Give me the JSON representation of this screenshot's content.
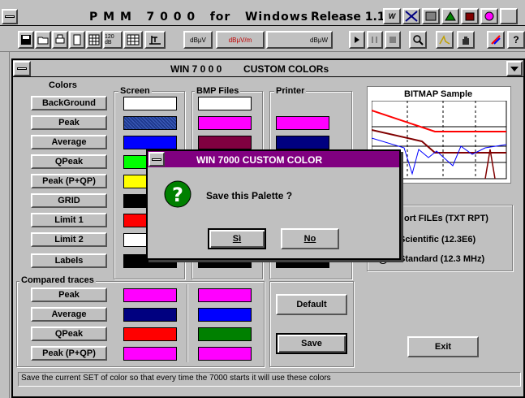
{
  "app": {
    "title": "P M M   7 0 0 0   for   Windows",
    "release": "Release 1.10"
  },
  "toolbar": {
    "unit_labels": [
      "dBμV",
      "dBμV/m",
      "dBμW"
    ],
    "bw_label": "120 dB"
  },
  "window": {
    "title": "WIN 7 0 0 0        CUSTOM COLORs"
  },
  "colors": {
    "section_label": "Colors",
    "columns": [
      "Screen",
      "BMP Files",
      "Printer"
    ],
    "rows": [
      {
        "label": "BackGround",
        "screen": "#ffffff",
        "bmp": "#ffffff",
        "printer": null
      },
      {
        "label": "Peak",
        "screen": "#1f3a8f",
        "bmp": "#ff00ff",
        "printer": "#ff00ff"
      },
      {
        "label": "Average",
        "screen": "#0000ff",
        "bmp": "#800040",
        "printer": "#000080"
      },
      {
        "label": "QPeak",
        "screen": "#00ff00",
        "bmp": null,
        "printer": null
      },
      {
        "label": "Peak  (P+QP)",
        "screen": "#ffff00",
        "bmp": null,
        "printer": null
      },
      {
        "label": "GRID",
        "screen": "#000000",
        "bmp": null,
        "printer": null
      },
      {
        "label": "Limit 1",
        "screen": "#ff0000",
        "bmp": null,
        "printer": null
      },
      {
        "label": "Limit 2",
        "screen": "#ffffff",
        "bmp": null,
        "printer": null
      },
      {
        "label": "Labels",
        "screen": "#000000",
        "bmp": "#000000",
        "printer": "#000000"
      }
    ]
  },
  "compared": {
    "section_label": "Compared traces",
    "rows": [
      {
        "label": "Peak",
        "screen": "#ff00ff",
        "bmp": "#ff00ff"
      },
      {
        "label": "Average",
        "screen": "#000080",
        "bmp": "#0000ff"
      },
      {
        "label": "QPeak",
        "screen": "#ff0000",
        "bmp": "#008000"
      },
      {
        "label": "Peak  (P+QP)",
        "screen": "#ff00ff",
        "bmp": "#ff00ff"
      }
    ]
  },
  "buttons": {
    "default": "Default",
    "save": "Save",
    "exit": "Exit"
  },
  "preview": {
    "label": "BITMAP Sample"
  },
  "export": {
    "group_label": "Export FILEs (TXT RPT)",
    "visible_group_label": "ort FILEs (TXT RPT)",
    "option_scientific": "Scientific (12.3E6)",
    "option_standard": "Standard (12.3 MHz)"
  },
  "dialog": {
    "title": "WIN 7000 CUSTOM COLOR",
    "message": "Save this Palette ?",
    "yes": "Sì",
    "no": "No"
  },
  "status": {
    "text": "Save the current SET of color so that every time the 7000 starts it will use these colors"
  }
}
